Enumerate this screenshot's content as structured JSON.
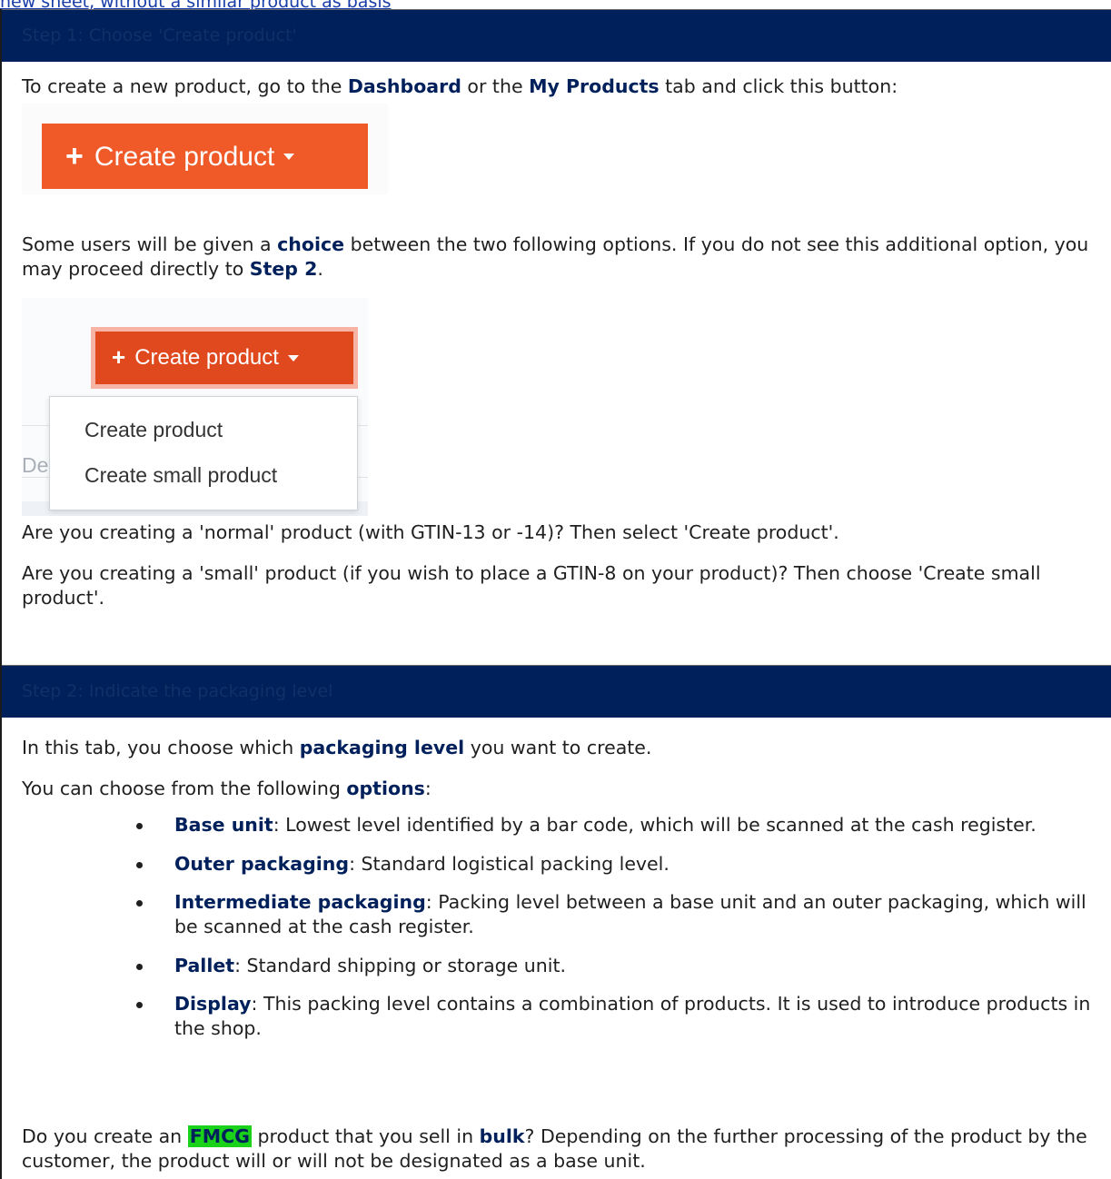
{
  "top_link": "new sheet, without a similar product as basis",
  "step1": {
    "title": "Step 1: Choose 'Create product'",
    "intro_pre": "To create a new product, go to the ",
    "intro_bold1": "Dashboard",
    "intro_mid": " or the ",
    "intro_bold2": "My Products",
    "intro_post": " tab and click this button:",
    "button_label": "Create product",
    "choice_pre": "Some users will be given a ",
    "choice_bold": "choice",
    "choice_mid": " between the two following options. If you do not see this additional option, you may proceed directly to ",
    "choice_bold2": "Step 2",
    "choice_post": ".",
    "dropdown_button": "Create product",
    "dropdown_items": [
      "Create product",
      "Create small product"
    ],
    "bg_fragment": "De",
    "normal_text": "Are you creating a 'normal' product (with GTIN-13 or -14)? Then select 'Create product'.",
    "small_text": "Are you creating a 'small' product (if you wish to place a GTIN-8 on your product)? Then choose 'Create small product'."
  },
  "step2": {
    "title": "Step 2: Indicate the packaging level",
    "tab_pre": "In this tab, you choose which ",
    "tab_bold": "packaging level",
    "tab_post": " you want to create.",
    "options_pre": "You can choose from the following ",
    "options_bold": "options",
    "options_post": ":",
    "options": [
      {
        "name": "Base unit",
        "desc": ": Lowest level identified by a bar code, which will be scanned at the cash register."
      },
      {
        "name": "Outer packaging",
        "desc": ": Standard logistical packing level."
      },
      {
        "name": "Intermediate packaging",
        "desc": ": Packing level between a base unit and an outer packaging, which will be scanned at the cash register."
      },
      {
        "name": "Pallet",
        "desc": ": Standard shipping or storage unit."
      },
      {
        "name": "Display",
        "desc": ": This packing level contains a combination of products. It is used to introduce products in the shop."
      }
    ],
    "fmcg_pre": "Do you create an ",
    "fmcg_highlight": "FMCG",
    "fmcg_mid": " product that you sell in ",
    "fmcg_bold": "bulk",
    "fmcg_post": "? Depending on the further processing of the product by the customer, the product will or will not be designated as a base unit."
  },
  "colors": {
    "header_bg": "#00205b",
    "button_orange": "#f05a28",
    "highlight_green": "#19d219"
  }
}
